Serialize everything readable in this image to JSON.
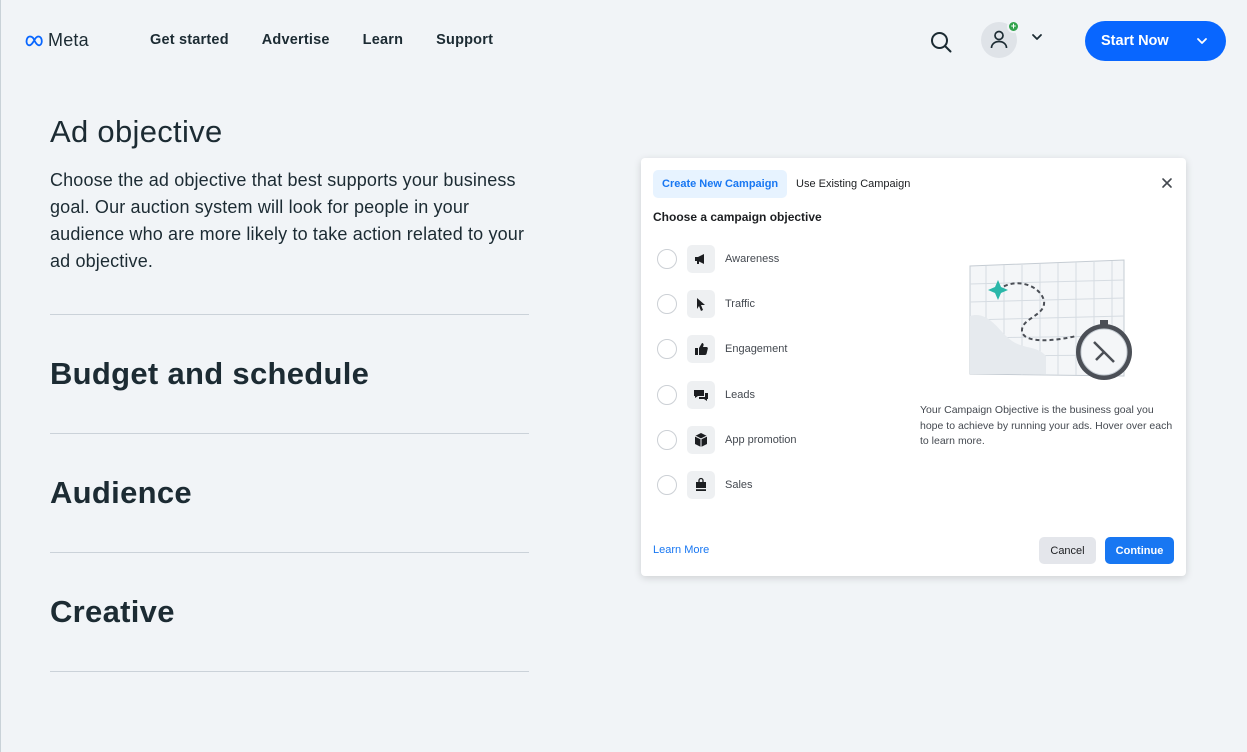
{
  "brand": {
    "name": "Meta",
    "accent": "#0866ff"
  },
  "nav": {
    "items": [
      "Get started",
      "Advertise",
      "Learn",
      "Support"
    ],
    "search_icon": "search-icon",
    "start_label": "Start Now"
  },
  "content": {
    "objective_title": "Ad objective",
    "objective_description": "Choose the ad objective that best supports your business goal. Our auction system will look for people in your audience who are more likely to take action related to your ad objective.",
    "sections": [
      "Budget and schedule",
      "Audience",
      "Creative"
    ]
  },
  "modal": {
    "tabs": [
      "Create New Campaign",
      "Use Existing Campaign"
    ],
    "title": "Choose a campaign objective",
    "options": [
      {
        "label": "Awareness",
        "icon": "megaphone-icon"
      },
      {
        "label": "Traffic",
        "icon": "cursor-icon"
      },
      {
        "label": "Engagement",
        "icon": "thumbs-up-icon"
      },
      {
        "label": "Leads",
        "icon": "chat-bubbles-icon"
      },
      {
        "label": "App promotion",
        "icon": "box-icon"
      },
      {
        "label": "Sales",
        "icon": "shopping-bag-icon"
      }
    ],
    "explanation": "Your Campaign Objective is the business goal you hope to achieve by running your ads. Hover over each to learn more.",
    "learn_more": "Learn More",
    "cancel": "Cancel",
    "continue": "Continue"
  }
}
